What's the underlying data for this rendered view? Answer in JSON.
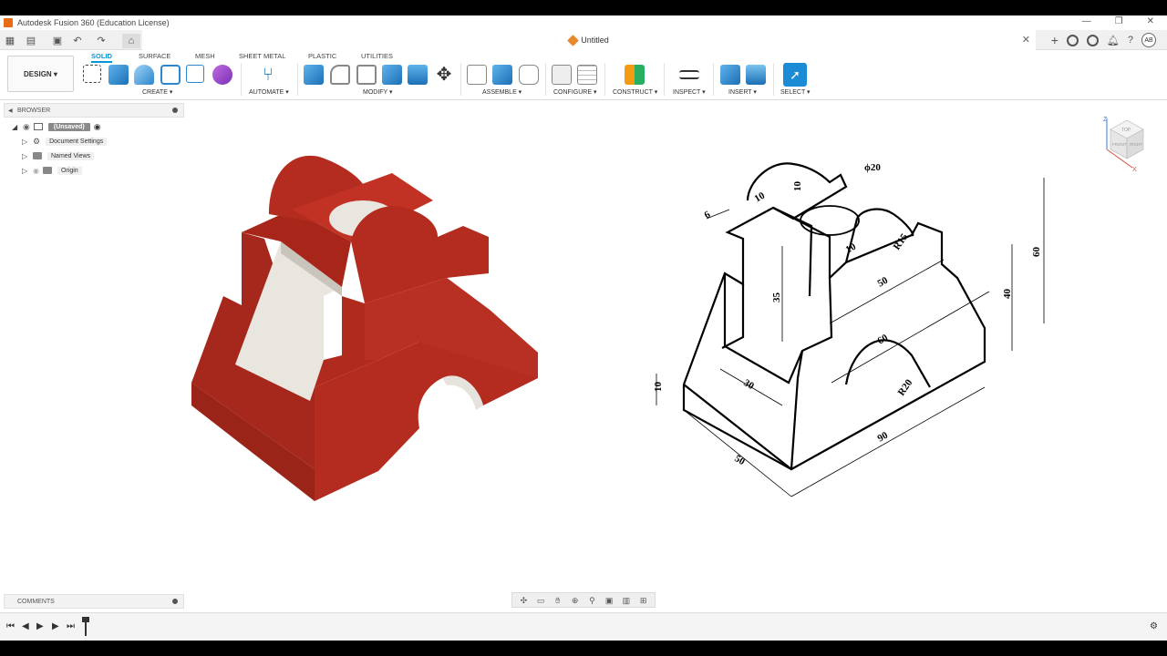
{
  "app": {
    "title": "Autodesk Fusion 360 (Education License)",
    "document_title": "Untitled",
    "user_initials": "AB"
  },
  "workspace": {
    "label": "DESIGN ▾"
  },
  "ribbon": {
    "tabs": [
      "SOLID",
      "SURFACE",
      "MESH",
      "SHEET METAL",
      "PLASTIC",
      "UTILITIES"
    ],
    "active_tab": "SOLID",
    "groups": [
      "CREATE ▾",
      "AUTOMATE ▾",
      "MODIFY ▾",
      "ASSEMBLE ▾",
      "CONFIGURE ▾",
      "CONSTRUCT ▾",
      "INSPECT ▾",
      "INSERT ▾",
      "SELECT ▾"
    ]
  },
  "browser": {
    "header": "BROWSER",
    "root": "(Unsaved)",
    "items": [
      "Document Settings",
      "Named Views",
      "Origin"
    ]
  },
  "comments": {
    "header": "COMMENTS"
  },
  "viewcube": {
    "axis_z": "Z",
    "axis_x": "X",
    "top": "TOP",
    "front": "FRONT",
    "right": "RIGHT"
  },
  "drawing": {
    "dimensions": [
      "ϕ20",
      "10",
      "10",
      "6",
      "R15",
      "10",
      "50",
      "35",
      "60",
      "40",
      "60",
      "30",
      "R20",
      "10",
      "90",
      "50"
    ]
  },
  "colors": {
    "model_body": "#b42b1f",
    "model_dark": "#8e2016",
    "accent": "#0696d7"
  }
}
